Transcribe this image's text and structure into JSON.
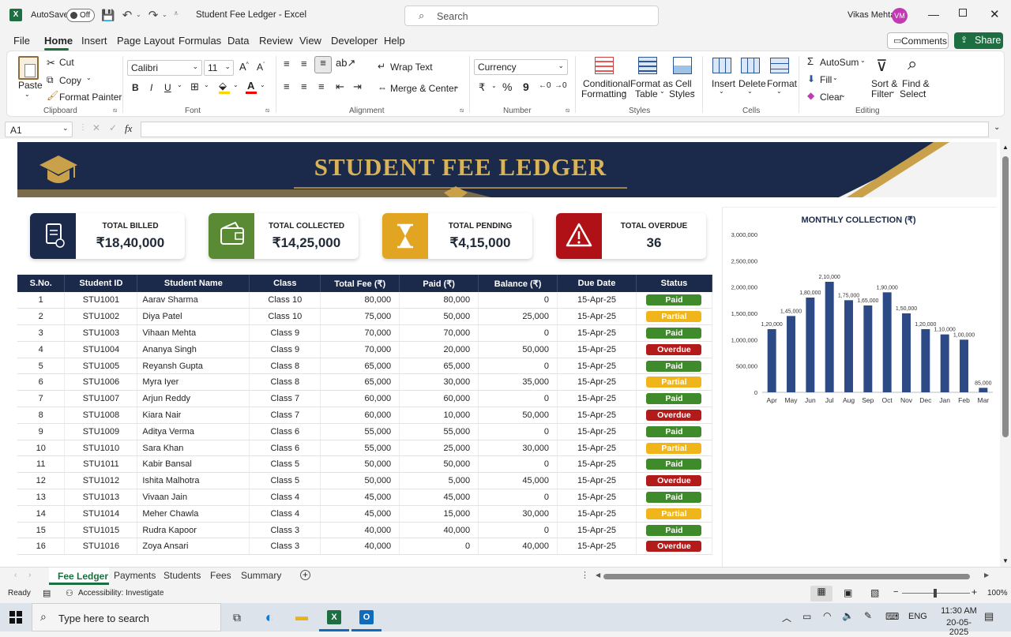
{
  "app": {
    "autosave_label": "AutoSave",
    "autosave_state": "Off",
    "doc_title": "Student Fee Ledger  -  Excel",
    "search_placeholder": "Search",
    "user_name": "Vikas Mehta",
    "user_initials": "VM"
  },
  "menu": {
    "items": [
      "File",
      "Home",
      "Insert",
      "Page Layout",
      "Formulas",
      "Data",
      "Review",
      "View",
      "Developer",
      "Help"
    ],
    "active": "Home",
    "comments_label": "Comments",
    "share_label": "Share"
  },
  "ribbon": {
    "clipboard": {
      "paste": "Paste",
      "cut": "Cut",
      "copy": "Copy",
      "format_painter": "Format Painter",
      "group": "Clipboard"
    },
    "font": {
      "family": "Calibri",
      "size": "11",
      "group": "Font",
      "bold": "B",
      "italic": "I",
      "underline": "U"
    },
    "alignment": {
      "wrap_text": "Wrap Text",
      "merge_center": "Merge & Center",
      "group": "Alignment"
    },
    "number": {
      "format": "Currency",
      "currency_symbol": "₹",
      "percent": "%",
      "comma": "9",
      "group": "Number"
    },
    "styles": {
      "conditional_1": "Conditional",
      "conditional_2": "Formatting",
      "format_table_1": "Format as",
      "format_table_2": "Table",
      "cell_styles_1": "Cell",
      "cell_styles_2": "Styles",
      "group": "Styles"
    },
    "cells": {
      "insert": "Insert",
      "delete": "Delete",
      "format": "Format",
      "group": "Cells"
    },
    "editing": {
      "autosum": "AutoSum",
      "fill": "Fill",
      "clear": "Clear",
      "sort_1": "Sort &",
      "sort_2": "Filter",
      "find_1": "Find &",
      "find_2": "Select",
      "group": "Editing"
    }
  },
  "formula_bar": {
    "name_box": "A1",
    "fx": "fx",
    "value": ""
  },
  "sheet": {
    "banner_title": "STUDENT FEE LEDGER",
    "colors": {
      "navy": "#1b2a4a",
      "gold": "#c9a14a",
      "green": "#4f8a2e",
      "amber": "#e2a521",
      "red": "#b01117",
      "paid": "#3f8a2a",
      "partial": "#f0b51a",
      "overdue": "#b31a1a"
    },
    "kpis": [
      {
        "label": "TOTAL BILLED",
        "value": "₹18,40,000",
        "icon": "document-icon",
        "color": "#1b2a4a"
      },
      {
        "label": "TOTAL COLLECTED",
        "value": "₹14,25,000",
        "icon": "wallet-icon",
        "color": "#5a8a34"
      },
      {
        "label": "TOTAL PENDING",
        "value": "₹4,15,000",
        "icon": "hourglass-icon",
        "color": "#e2a521"
      },
      {
        "label": "TOTAL OVERDUE",
        "value": "36",
        "icon": "warning-icon",
        "color": "#b01117"
      }
    ],
    "columns": [
      "S.No.",
      "Student ID",
      "Student Name",
      "Class",
      "Total Fee (₹)",
      "Paid (₹)",
      "Balance (₹)",
      "Due Date",
      "Status"
    ],
    "rows": [
      [
        "1",
        "STU1001",
        "Aarav Sharma",
        "Class 10",
        "80,000",
        "80,000",
        "0",
        "15-Apr-25",
        "Paid"
      ],
      [
        "2",
        "STU1002",
        "Diya Patel",
        "Class 10",
        "75,000",
        "50,000",
        "25,000",
        "15-Apr-25",
        "Partial"
      ],
      [
        "3",
        "STU1003",
        "Vihaan Mehta",
        "Class 9",
        "70,000",
        "70,000",
        "0",
        "15-Apr-25",
        "Paid"
      ],
      [
        "4",
        "STU1004",
        "Ananya Singh",
        "Class 9",
        "70,000",
        "20,000",
        "50,000",
        "15-Apr-25",
        "Overdue"
      ],
      [
        "5",
        "STU1005",
        "Reyansh Gupta",
        "Class 8",
        "65,000",
        "65,000",
        "0",
        "15-Apr-25",
        "Paid"
      ],
      [
        "6",
        "STU1006",
        "Myra Iyer",
        "Class 8",
        "65,000",
        "30,000",
        "35,000",
        "15-Apr-25",
        "Partial"
      ],
      [
        "7",
        "STU1007",
        "Arjun Reddy",
        "Class 7",
        "60,000",
        "60,000",
        "0",
        "15-Apr-25",
        "Paid"
      ],
      [
        "8",
        "STU1008",
        "Kiara Nair",
        "Class 7",
        "60,000",
        "10,000",
        "50,000",
        "15-Apr-25",
        "Overdue"
      ],
      [
        "9",
        "STU1009",
        "Aditya Verma",
        "Class 6",
        "55,000",
        "55,000",
        "0",
        "15-Apr-25",
        "Paid"
      ],
      [
        "10",
        "STU1010",
        "Sara Khan",
        "Class 6",
        "55,000",
        "25,000",
        "30,000",
        "15-Apr-25",
        "Partial"
      ],
      [
        "11",
        "STU1011",
        "Kabir Bansal",
        "Class 5",
        "50,000",
        "50,000",
        "0",
        "15-Apr-25",
        "Paid"
      ],
      [
        "12",
        "STU1012",
        "Ishita Malhotra",
        "Class 5",
        "50,000",
        "5,000",
        "45,000",
        "15-Apr-25",
        "Overdue"
      ],
      [
        "13",
        "STU1013",
        "Vivaan Jain",
        "Class 4",
        "45,000",
        "45,000",
        "0",
        "15-Apr-25",
        "Paid"
      ],
      [
        "14",
        "STU1014",
        "Meher Chawla",
        "Class 4",
        "45,000",
        "15,000",
        "30,000",
        "15-Apr-25",
        "Partial"
      ],
      [
        "15",
        "STU1015",
        "Rudra Kapoor",
        "Class 3",
        "40,000",
        "40,000",
        "0",
        "15-Apr-25",
        "Paid"
      ],
      [
        "16",
        "STU1016",
        "Zoya Ansari",
        "Class 3",
        "40,000",
        "0",
        "40,000",
        "15-Apr-25",
        "Overdue"
      ]
    ]
  },
  "chart_data": {
    "type": "bar",
    "title": "MONTHLY COLLECTION (₹)",
    "categories": [
      "Apr",
      "May",
      "Jun",
      "Jul",
      "Aug",
      "Sep",
      "Oct",
      "Nov",
      "Dec",
      "Jan",
      "Feb",
      "Mar"
    ],
    "values": [
      1200000,
      1450000,
      1800000,
      2100000,
      1750000,
      1650000,
      1900000,
      1500000,
      1200000,
      1100000,
      1000000,
      85000
    ],
    "data_labels": [
      "1,20,000",
      "1,45,000",
      "1,80,000",
      "2,10,000",
      "1,75,000",
      "1,65,000",
      "1,90,000",
      "1,50,000",
      "1,20,000",
      "1,10,000",
      "1,00,000",
      "85,000"
    ],
    "yticks": [
      0,
      500000,
      1000000,
      1500000,
      2000000,
      2500000,
      3000000
    ],
    "ytick_labels": [
      "0",
      "500,000",
      "1,000,000",
      "1,500,000",
      "2,000,000",
      "2,500,000",
      "3,000,000"
    ],
    "ylim": [
      0,
      3000000
    ],
    "bar_color": "#2b4a86",
    "grid": false
  },
  "sheet_tabs": {
    "items": [
      "Fee Ledger",
      "Payments",
      "Students",
      "Fees",
      "Summary"
    ],
    "active": "Fee Ledger"
  },
  "status": {
    "ready": "Ready",
    "accessibility": "Accessibility: Investigate",
    "zoom": "100%"
  },
  "taskbar": {
    "search_placeholder": "Type here to search",
    "lang": "ENG",
    "time": "11:30 AM",
    "date": "20-05-2025"
  }
}
